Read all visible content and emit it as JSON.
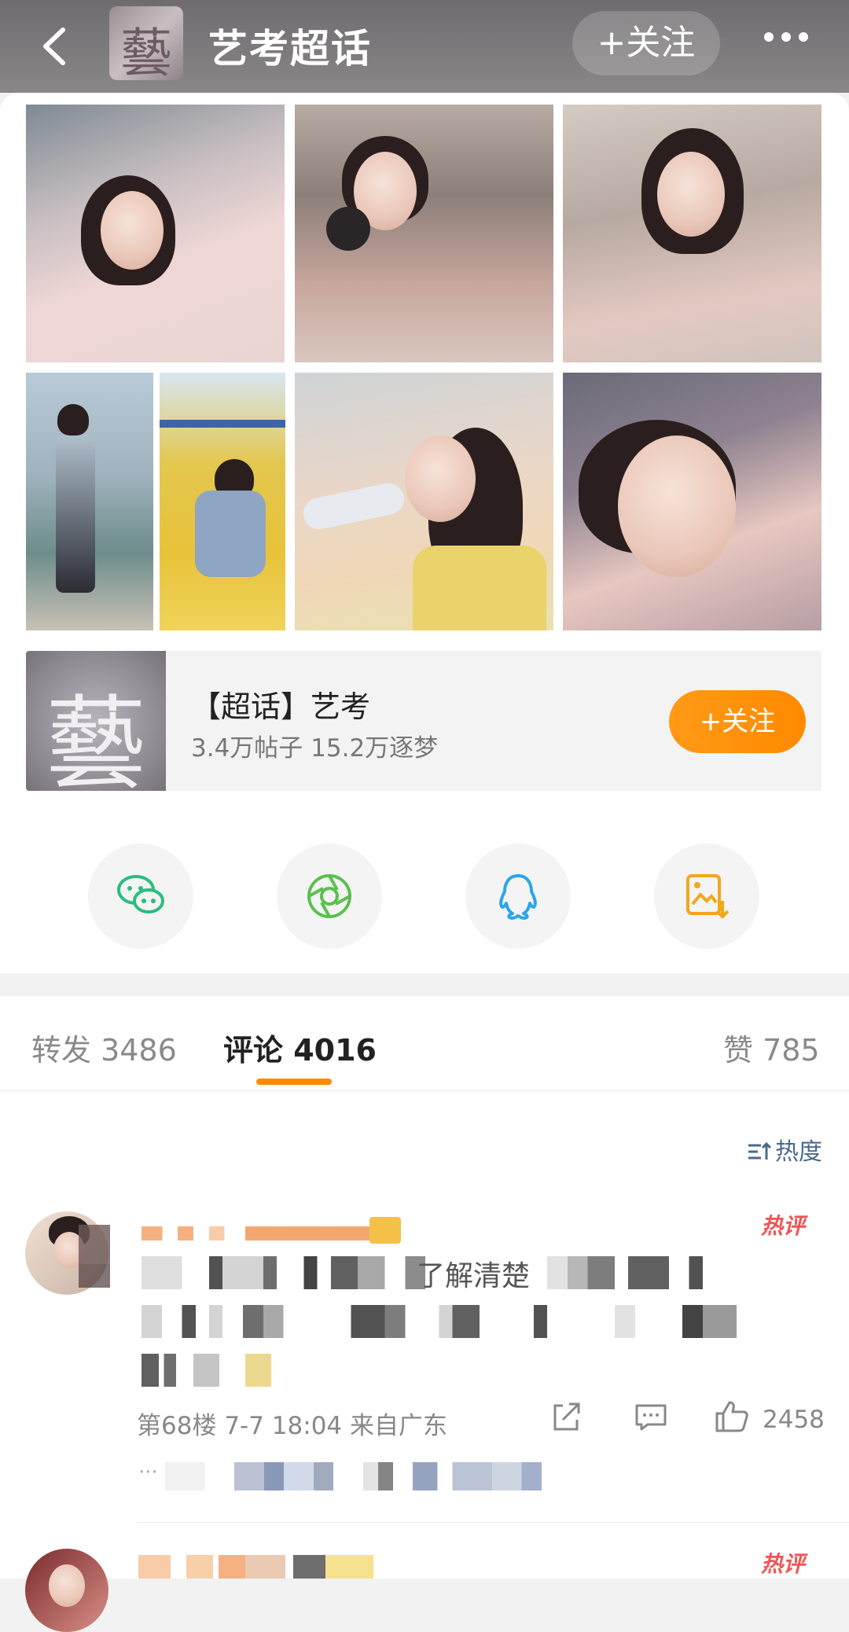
{
  "header": {
    "title": "艺考超话",
    "avatar_char": "藝",
    "follow_label": "+关注"
  },
  "topic": {
    "avatar_char": "藝",
    "name": "【超话】艺考",
    "stats": "3.4万帖子 15.2万逐梦",
    "follow_label": "+关注"
  },
  "share": [
    "wechat",
    "moments",
    "qq",
    "save-image"
  ],
  "tabs": {
    "repost": "转发 3486",
    "comments": "评论 4016",
    "likes": "赞 785"
  },
  "sort": {
    "label": "热度"
  },
  "comment": {
    "hot_label": "热评",
    "floor": "第68楼",
    "time": "7-7 18:04",
    "location": "来自广东",
    "like_count": "2458",
    "visible_fragment": "了解清楚"
  },
  "comment2": {
    "hot_label": "热评"
  },
  "colors": {
    "accent": "#ff8a00",
    "sort_text": "#4a6a8c",
    "hot": "#e55555"
  }
}
